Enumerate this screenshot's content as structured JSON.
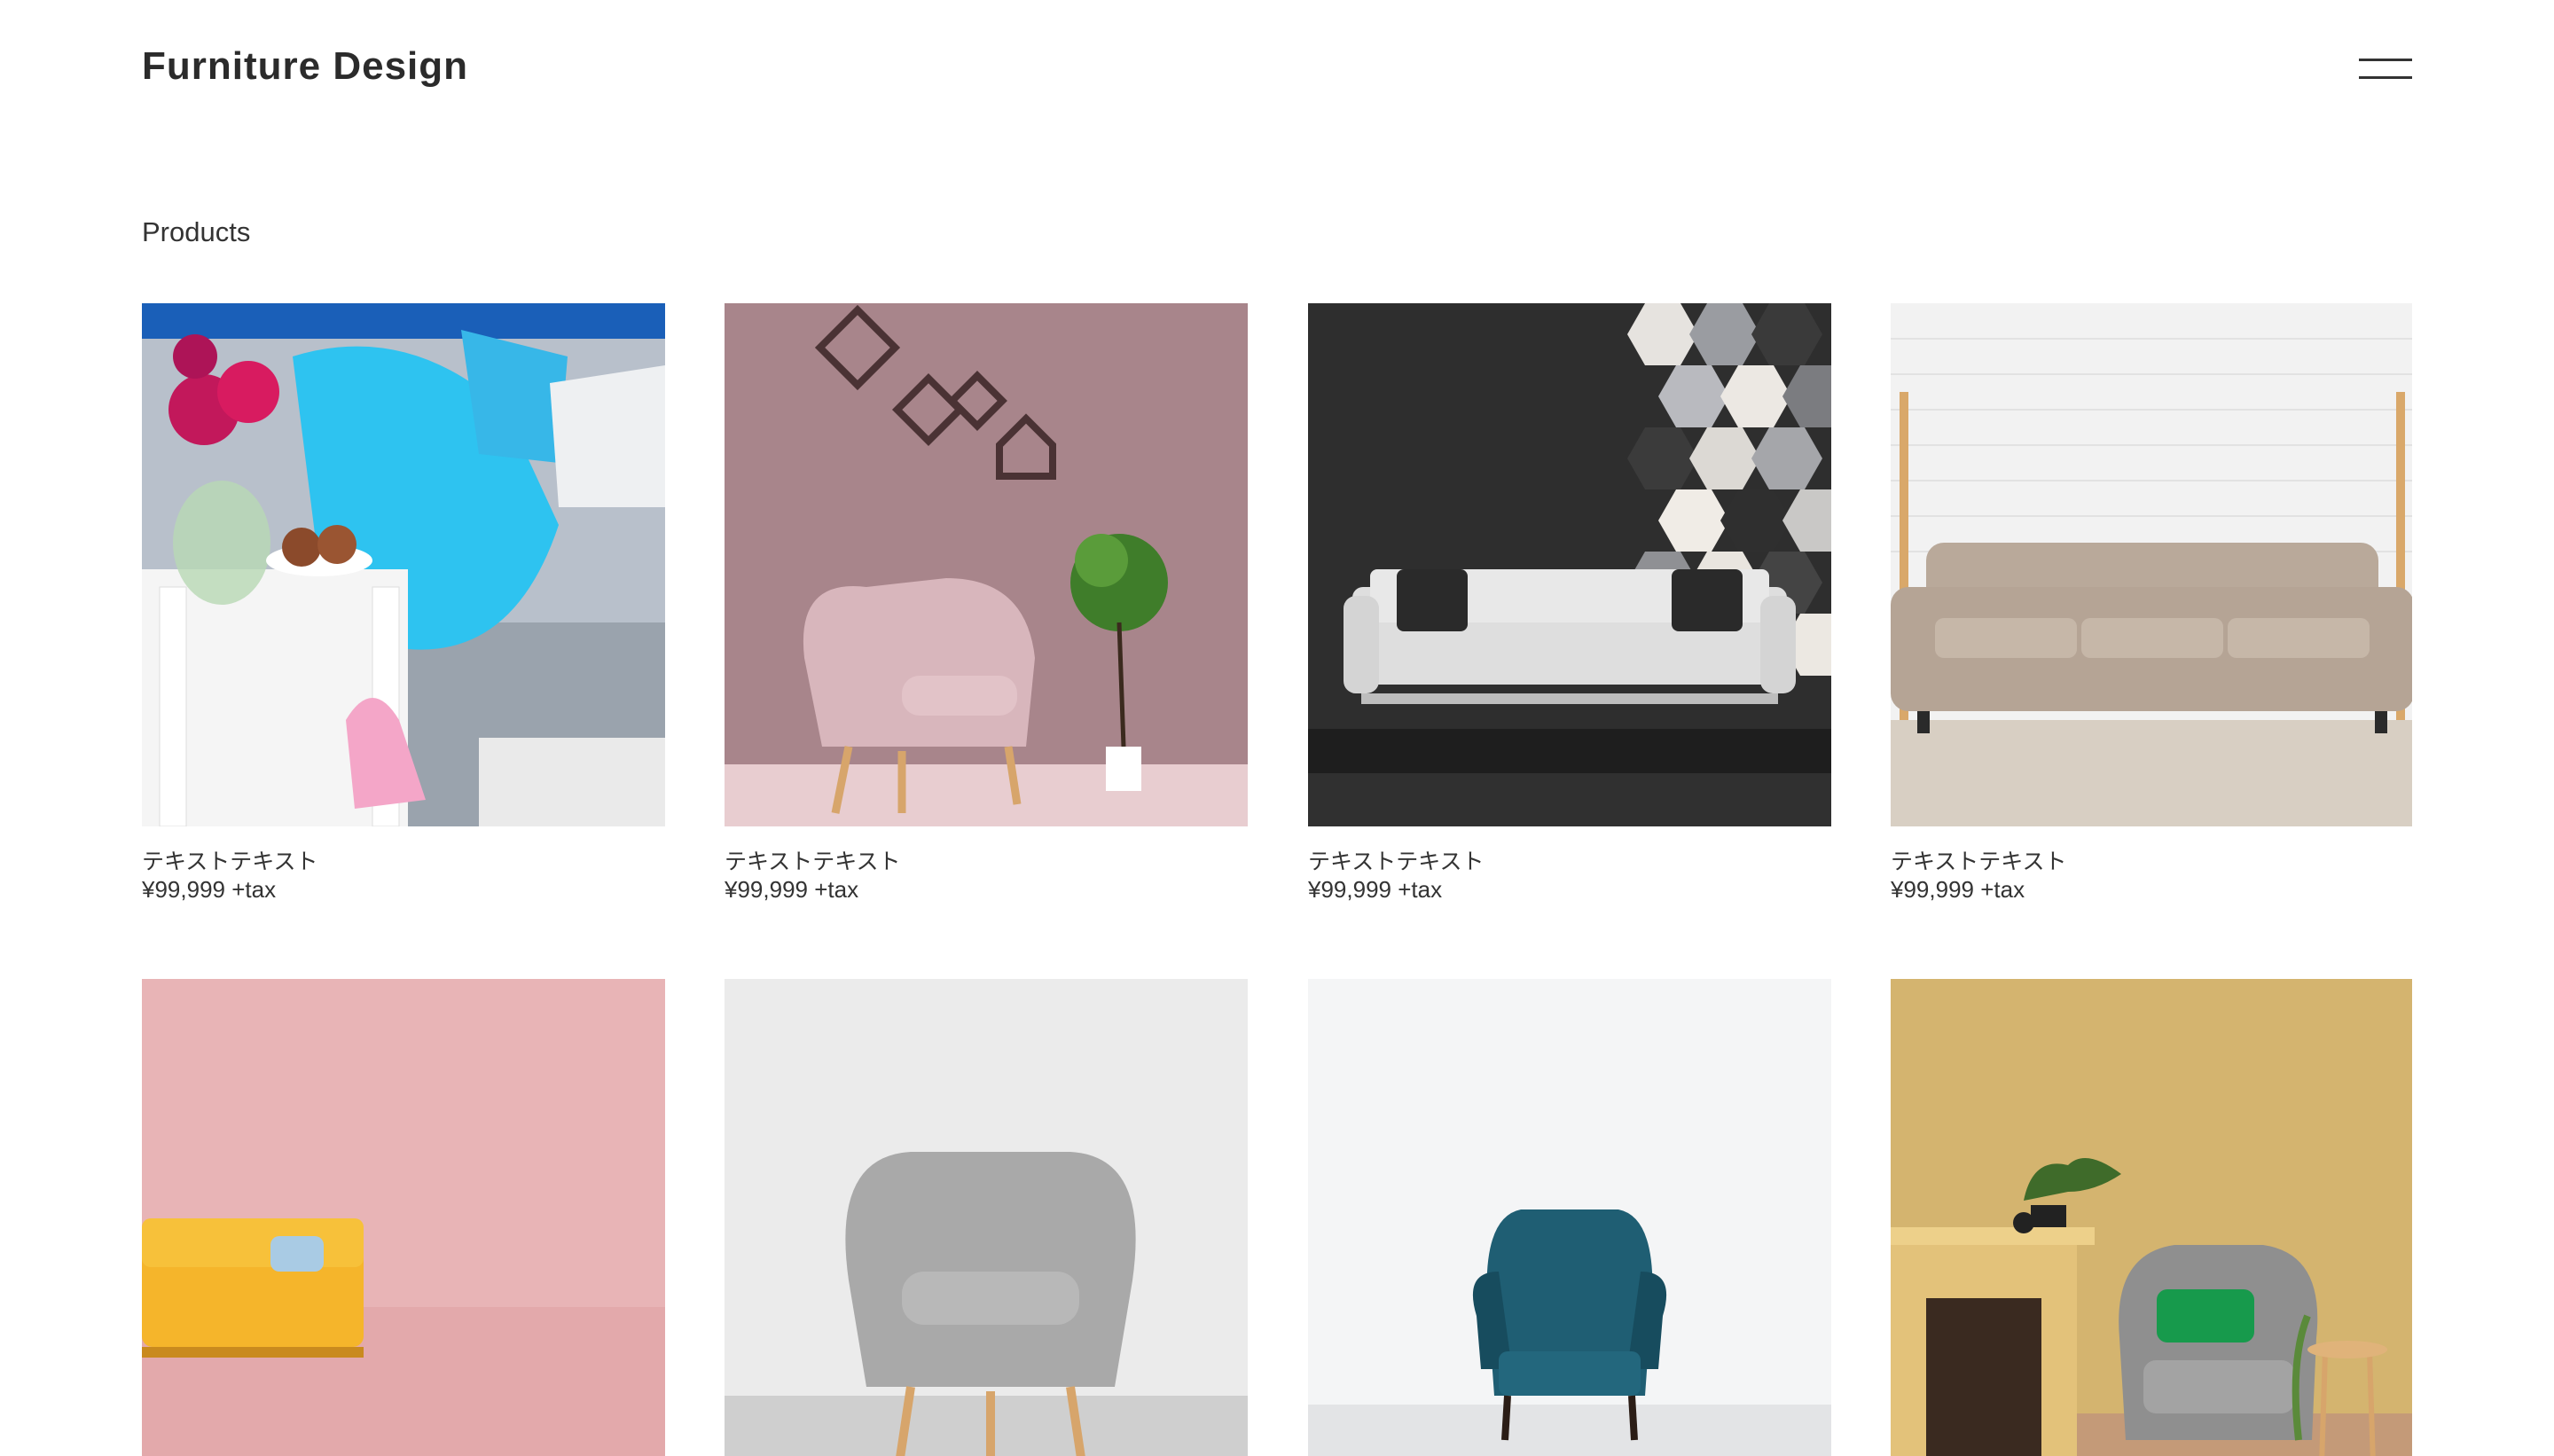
{
  "header": {
    "logo": "Furniture Design",
    "menu_icon": "hamburger-menu-icon"
  },
  "products_section": {
    "title": "Products",
    "items": [
      {
        "name": "テキストテキスト",
        "price": "¥99,999 +tax",
        "image": "blue-knit-blanket-sofa-flowers"
      },
      {
        "name": "テキストテキスト",
        "price": "¥99,999 +tax",
        "image": "pink-armchair-mauve-wall"
      },
      {
        "name": "テキストテキスト",
        "price": "¥99,999 +tax",
        "image": "white-sofa-hexagon-wall"
      },
      {
        "name": "テキストテキスト",
        "price": "¥99,999 +tax",
        "image": "beige-sofa-brick-wall"
      },
      {
        "name": "",
        "price": "",
        "image": "yellow-sofa-pink-background"
      },
      {
        "name": "",
        "price": "",
        "image": "grey-armchair-white-wall"
      },
      {
        "name": "",
        "price": "",
        "image": "teal-velvet-wingback-chair"
      },
      {
        "name": "",
        "price": "",
        "image": "grey-armchair-fireplace-gold-wall"
      }
    ]
  }
}
